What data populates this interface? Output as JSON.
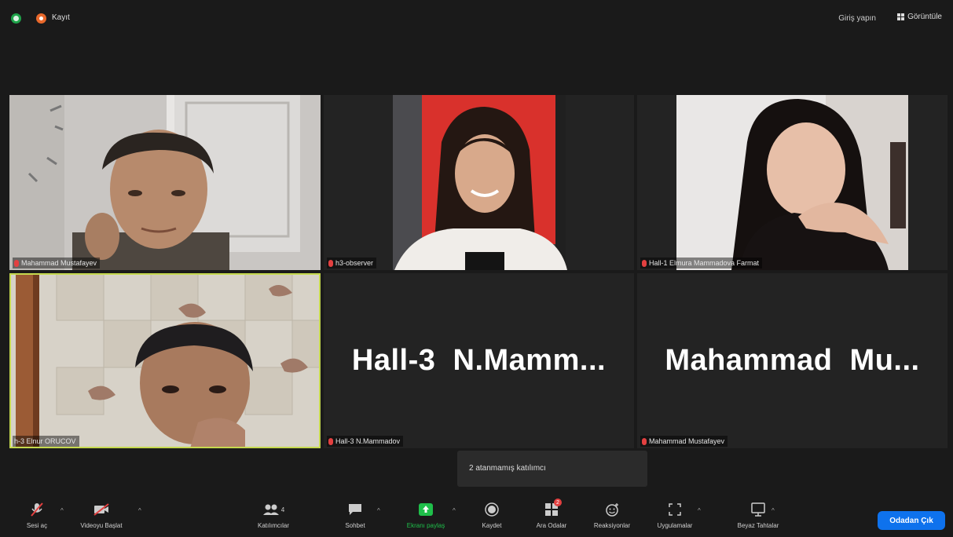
{
  "topbar": {
    "record_label": "Kayıt",
    "signin_label": "Giriş yapın",
    "view_label": "Görüntüle"
  },
  "tiles": [
    {
      "name": "Mahammad Mustafayev",
      "muted": true,
      "video": true
    },
    {
      "name": "h3-observer",
      "muted": true,
      "video": true
    },
    {
      "name": "Hall-1 Elmura Mammadova Farmat",
      "muted": true,
      "video": true
    },
    {
      "name": "h-3 Elnur ORUCOV",
      "muted": false,
      "video": true,
      "active_speaker": true
    },
    {
      "name": "Hall-3 N.Mammadov",
      "display_name": "Hall-3  N.Mamm...",
      "muted": true,
      "video": false
    },
    {
      "name": "Mahammad Mustafayev",
      "display_name": "Mahammad  Mu...",
      "muted": true,
      "video": false
    }
  ],
  "tooltip": {
    "text": "2 atanmamış katılımcı"
  },
  "toolbar": {
    "unmute": "Sesi aç",
    "start_video": "Videoyu Başlat",
    "participants": "Katılımcılar",
    "participants_count": "4",
    "chat": "Sohbet",
    "share_screen": "Ekranı paylaş",
    "record": "Kaydet",
    "breakout_rooms": "Ara Odalar",
    "breakout_badge": "2",
    "reactions": "Reaksiyonlar",
    "apps": "Uygulamalar",
    "whiteboards": "Beyaz Tahtalar",
    "leave": "Odadan Çık"
  },
  "colors": {
    "accent_blue": "#0e72ed",
    "share_green": "#1fbf4a",
    "muted_red": "#e34040",
    "active_speaker": "#c5d94e"
  }
}
